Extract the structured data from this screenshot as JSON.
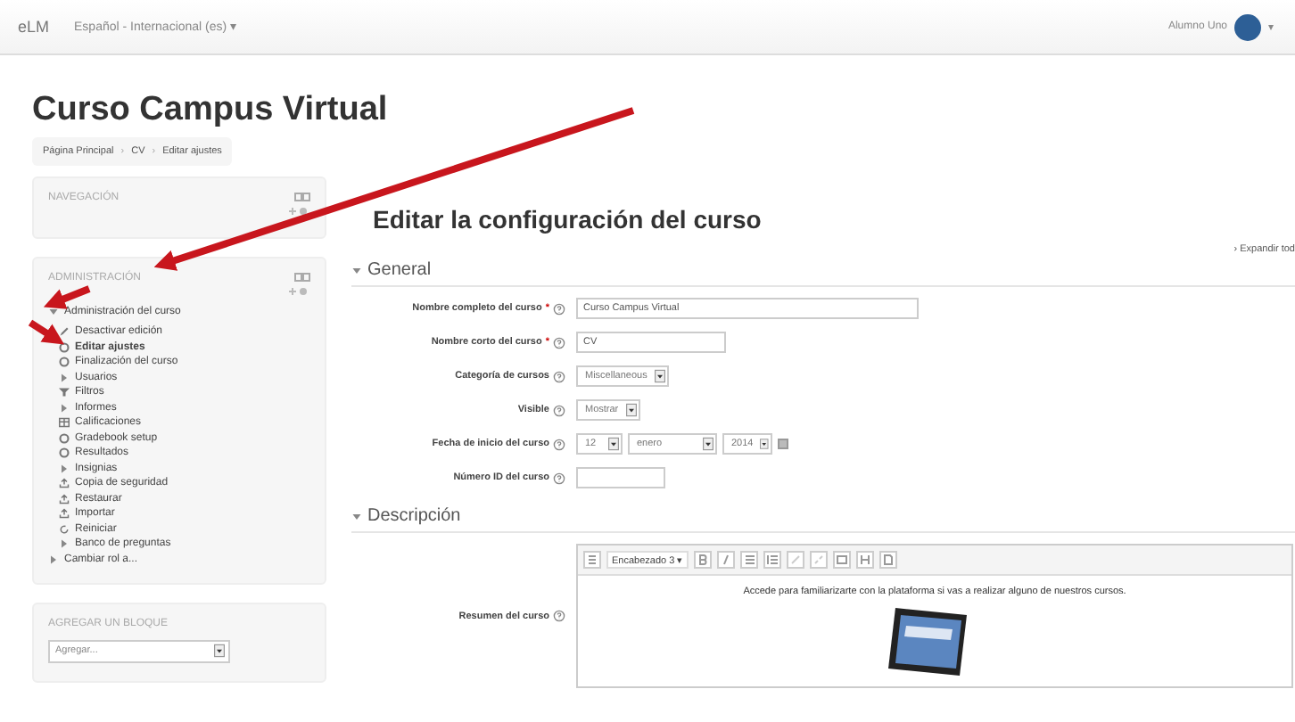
{
  "navbar": {
    "brand": "eLM",
    "language": "Español - Internacional (es) ▾",
    "user": "Alumno Uno",
    "user_caret": "▾"
  },
  "page_title": "Curso Campus Virtual",
  "breadcrumb": [
    {
      "kind": "link",
      "text": "Página Principal"
    },
    {
      "kind": "separator",
      "text": "›"
    },
    {
      "kind": "link",
      "text": "CV"
    },
    {
      "kind": "separator",
      "text": "›"
    },
    {
      "kind": "link",
      "text": "Editar ajustes"
    }
  ],
  "blocks": [
    {
      "title": "NAVEGACIÓN"
    },
    {
      "title": "ADMINISTRACIÓN",
      "items": [
        {
          "label": "Administración del curso",
          "bold": false,
          "children": [
            {
              "label": "Desactivar edición",
              "bold": false
            },
            {
              "label": "Editar ajustes",
              "bold": true
            },
            {
              "label": "Finalización del curso",
              "bold": false
            },
            {
              "label": "Usuarios",
              "bold": false
            },
            {
              "label": "Filtros",
              "bold": false
            },
            {
              "label": "Informes",
              "bold": false
            },
            {
              "label": "Calificaciones",
              "bold": false
            },
            {
              "label": "Gradebook setup",
              "bold": false
            },
            {
              "label": "Resultados",
              "bold": false
            },
            {
              "label": "Insignias",
              "bold": false
            },
            {
              "label": "Copia de seguridad",
              "bold": false
            },
            {
              "label": "Restaurar",
              "bold": false
            },
            {
              "label": "Importar",
              "bold": false
            },
            {
              "label": "Reiniciar",
              "bold": false
            },
            {
              "label": "Banco de preguntas",
              "bold": false
            }
          ]
        },
        {
          "label": "Cambiar rol a...",
          "bold": false
        }
      ]
    }
  ],
  "add_block": {
    "title": "AGREGAR UN BLOQUE",
    "select": "Agregar..."
  },
  "form": {
    "title": "Editar la configuración del curso",
    "expand_link": "› Expandir tod",
    "sections": [
      {
        "title": "General",
        "fields": [
          {
            "kind": "text",
            "label": "Nombre completo del curso",
            "required_mark": "*",
            "value": "Curso Campus Virtual"
          },
          {
            "kind": "text",
            "label": "Nombre corto del curso",
            "required_mark": "*",
            "value": "CV"
          },
          {
            "kind": "select",
            "label": "Categoría de cursos",
            "values": [
              "Miscellaneous"
            ]
          },
          {
            "kind": "select",
            "label": "Visible",
            "values": [
              "Mostrar"
            ]
          },
          {
            "kind": "date",
            "label": "Fecha de inicio del curso",
            "values": [
              "12",
              "enero",
              "2014"
            ]
          },
          {
            "kind": "text",
            "label": "Número ID del curso"
          }
        ]
      },
      {
        "title": "Descripción",
        "fields": [
          {
            "kind": "editor",
            "label": "Resumen del curso",
            "format": "Encabezado 3 ▾",
            "text": "Accede para familiarizarte con la plataforma si vas a realizar alguno de nuestros cursos."
          }
        ]
      }
    ]
  }
}
